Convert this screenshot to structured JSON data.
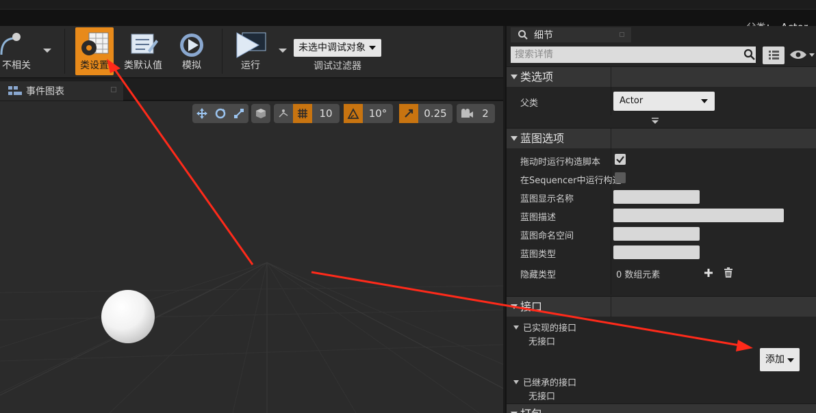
{
  "header": {
    "parent_prefix": "父类：",
    "parent_value": "Actor"
  },
  "toolbar": {
    "irrelevant_label": "不相关",
    "class_settings_label": "类设置",
    "class_defaults_label": "类默认值",
    "simulate_label": "模拟",
    "run_label": "运行",
    "debug_object": "未选中调试对象",
    "debug_filter_label": "调试过滤器"
  },
  "graph_tab": {
    "label": "事件图表"
  },
  "viewport_tools": {
    "grid_size": "10",
    "rotation_snap": "10°",
    "scale_snap": "0.25",
    "camera_speed": "2"
  },
  "details": {
    "tab_label": "细节",
    "search_placeholder": "搜索详情",
    "class_options": {
      "title": "类选项",
      "parent_label": "父类",
      "parent_value": "Actor"
    },
    "blueprint_options": {
      "title": "蓝图选项",
      "run_construction_on_drag": "拖动时运行构造脚本",
      "run_construction_in_sequencer": "在Sequencer中运行构造",
      "display_name": "蓝图显示名称",
      "description": "蓝图描述",
      "namespace": "蓝图命名空间",
      "type": "蓝图类型",
      "hide_categories": "隐藏类型",
      "hide_categories_value": "0 数组元素"
    },
    "interfaces": {
      "title": "接口",
      "implemented_label": "已实现的接口",
      "implemented_none": "无接口",
      "add_button": "添加",
      "inherited_label": "已继承的接口",
      "inherited_none": "无接口"
    },
    "packaging": {
      "title": "打包"
    }
  },
  "colors": {
    "accent_orange": "#e88a1a",
    "annotation_red": "#ff2a1a"
  }
}
